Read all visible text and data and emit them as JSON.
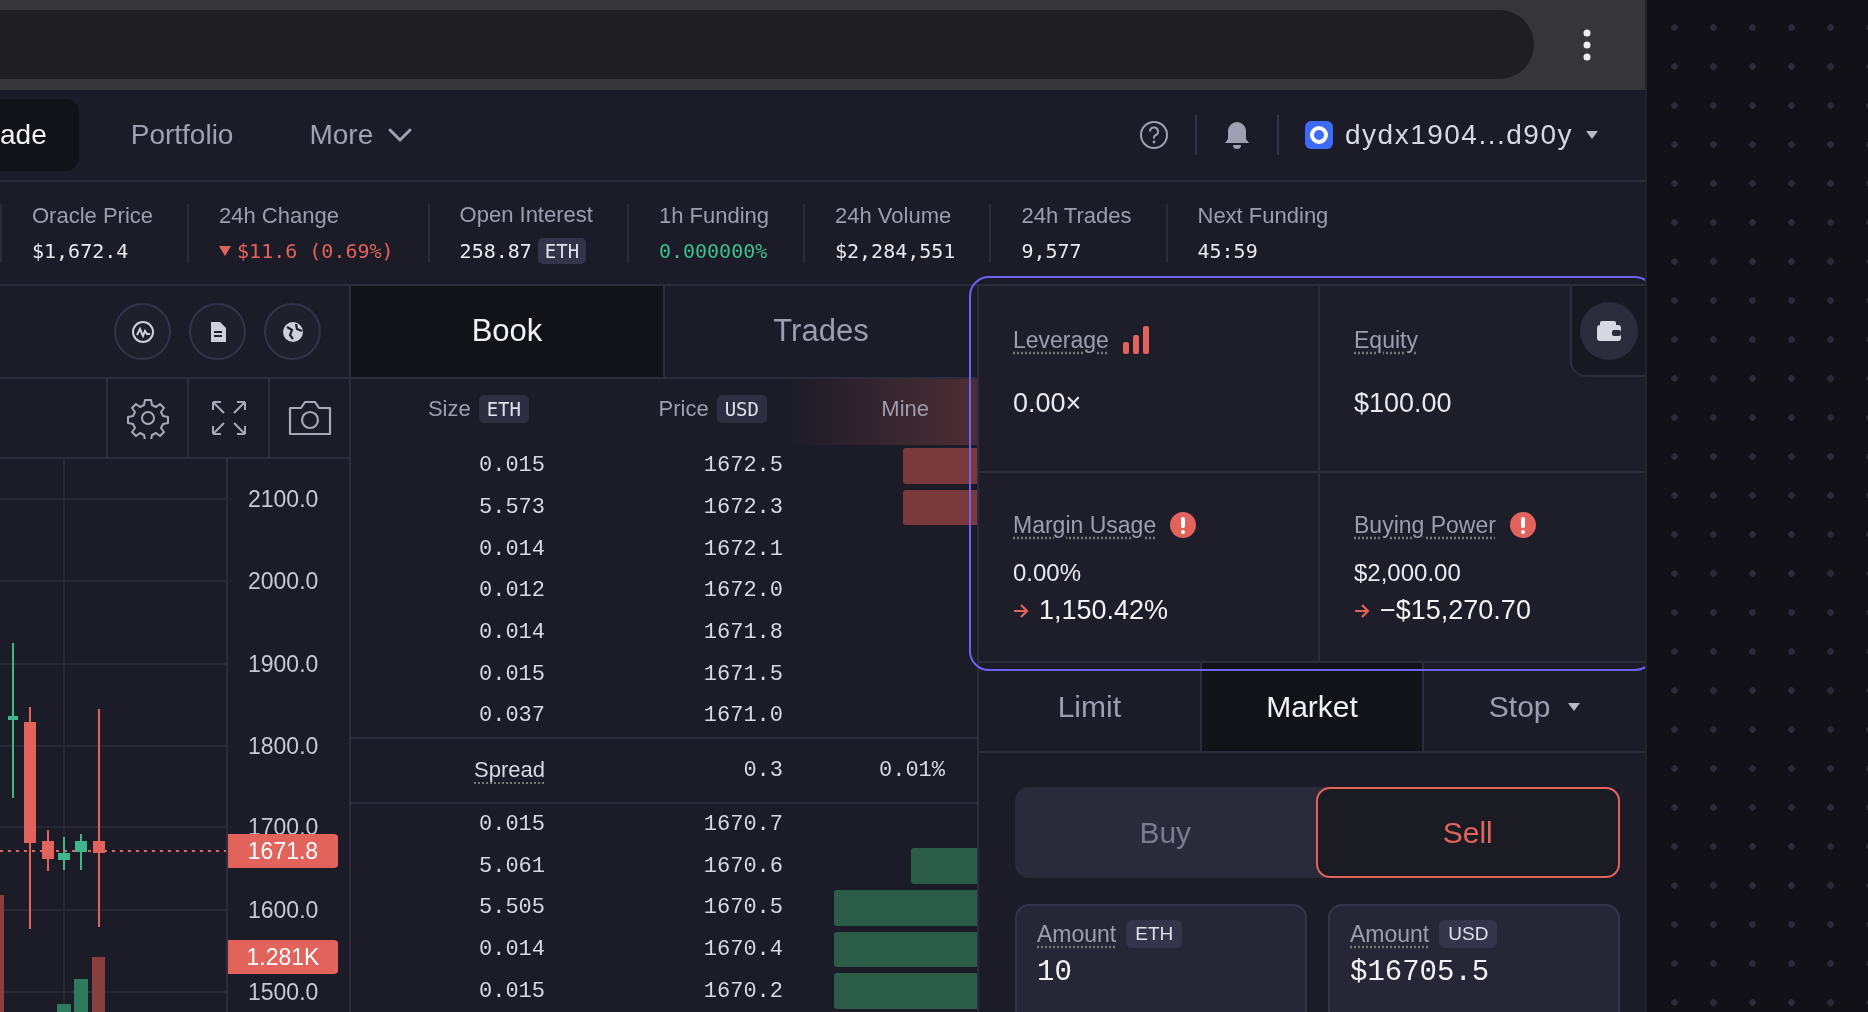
{
  "nav": {
    "tabs": [
      {
        "label": "ade",
        "selected": true,
        "dropdown": false
      },
      {
        "label": "Portfolio",
        "selected": false,
        "dropdown": false
      },
      {
        "label": "More",
        "selected": false,
        "dropdown": true
      }
    ],
    "account": "dydx1904...d90y"
  },
  "stats": [
    {
      "label": "Oracle Price",
      "value": "$1,672.4",
      "kind": "plain"
    },
    {
      "label": "24h Change",
      "value": "$11.6 (0.69%)",
      "kind": "down"
    },
    {
      "label": "Open Interest",
      "value": "258.87",
      "unit": "ETH",
      "kind": "plain"
    },
    {
      "label": "1h Funding",
      "value": "0.000000%",
      "kind": "up"
    },
    {
      "label": "24h Volume",
      "value": "$2,284,551",
      "kind": "plain"
    },
    {
      "label": "24h Trades",
      "value": "9,577",
      "kind": "plain"
    },
    {
      "label": "Next Funding",
      "value": "45:59",
      "kind": "plain"
    }
  ],
  "chart": {
    "y_axis": [
      "2100.0",
      "2000.0",
      "1900.0",
      "1800.0",
      "1700.0",
      "1600.0",
      "1500.0"
    ],
    "last_price": "1671.8",
    "volume": "1.281K"
  },
  "book": {
    "tabs": [
      {
        "label": "Book",
        "selected": true
      },
      {
        "label": "Trades",
        "selected": false
      }
    ],
    "columns": [
      {
        "label": "Size",
        "unit": "ETH"
      },
      {
        "label": "Price",
        "unit": "USD"
      },
      {
        "label": "Mine"
      }
    ],
    "asks": [
      {
        "size": "0.015",
        "price": "1672.5"
      },
      {
        "size": "5.573",
        "price": "1672.3"
      },
      {
        "size": "0.014",
        "price": "1672.1"
      },
      {
        "size": "0.012",
        "price": "1672.0"
      },
      {
        "size": "0.014",
        "price": "1671.8"
      },
      {
        "size": "0.015",
        "price": "1671.5"
      },
      {
        "size": "0.037",
        "price": "1671.0"
      }
    ],
    "spread": {
      "label": "Spread",
      "value": "0.3",
      "percent": "0.01%"
    },
    "bids": [
      {
        "size": "0.015",
        "price": "1670.7"
      },
      {
        "size": "5.061",
        "price": "1670.6"
      },
      {
        "size": "5.505",
        "price": "1670.5"
      },
      {
        "size": "0.014",
        "price": "1670.4"
      },
      {
        "size": "0.015",
        "price": "1670.2"
      }
    ]
  },
  "account": {
    "cells": [
      {
        "kind": "leverage",
        "label": "Leverage",
        "value": "0.00×"
      },
      {
        "kind": "plain",
        "label": "Equity",
        "value": "$100.00"
      },
      {
        "kind": "warning",
        "label": "Margin Usage",
        "value": "0.00%",
        "projected": "1,150.42%"
      },
      {
        "kind": "warning",
        "label": "Buying Power",
        "value": "$2,000.00",
        "projected": "−$15,270.70"
      }
    ]
  },
  "order": {
    "types": [
      {
        "label": "Limit",
        "selected": false,
        "dropdown": false
      },
      {
        "label": "Market",
        "selected": true,
        "dropdown": false
      },
      {
        "label": "Stop",
        "selected": false,
        "dropdown": true
      }
    ],
    "sides": [
      {
        "label": "Buy",
        "selected": false,
        "kind": "buy"
      },
      {
        "label": "Sell",
        "selected": true,
        "kind": "sell"
      }
    ],
    "fields": [
      {
        "label": "Amount",
        "unit": "ETH",
        "value": "10"
      },
      {
        "label": "Amount",
        "unit": "USD",
        "value": "$16705.5"
      }
    ]
  }
}
